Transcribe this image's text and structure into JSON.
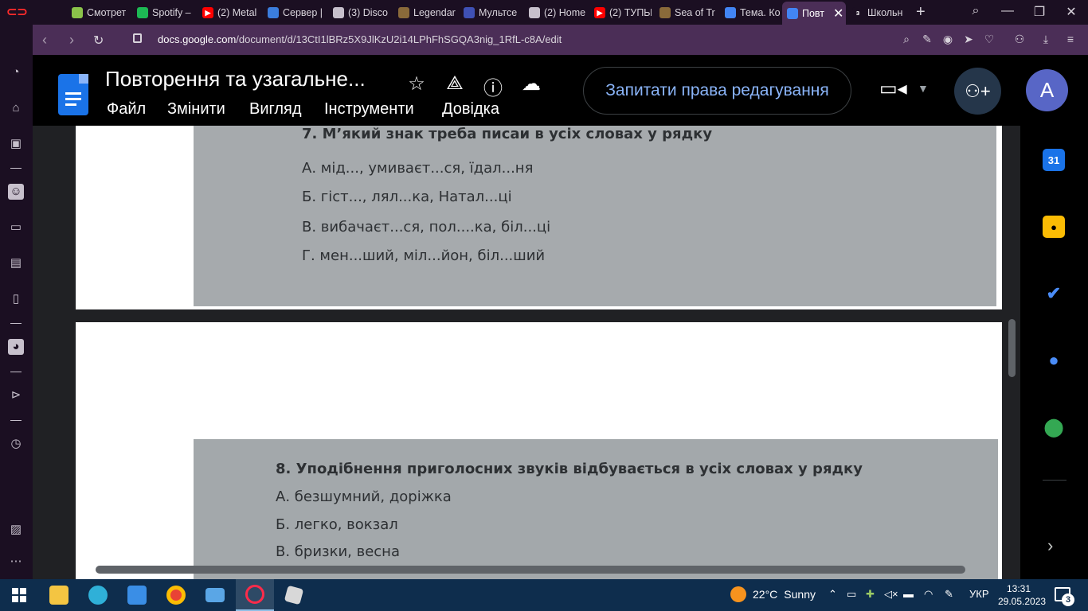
{
  "browser": {
    "tabs": [
      {
        "label": "Смотрет",
        "color": "#8bc34a",
        "glyph": ""
      },
      {
        "label": "Spotify –",
        "color": "#1db954",
        "glyph": ""
      },
      {
        "label": "(2) Metal",
        "color": "#ff0000",
        "glyph": "▶"
      },
      {
        "label": "Сервер |",
        "color": "#3b7ddd",
        "glyph": ""
      },
      {
        "label": "(3) Disco",
        "color": "#c7c0cc",
        "glyph": ""
      },
      {
        "label": "Legendar",
        "color": "#8a6a3a",
        "glyph": ""
      },
      {
        "label": "Мультсе",
        "color": "#3f51b5",
        "glyph": ""
      },
      {
        "label": "(2) Home",
        "color": "#c7c0cc",
        "glyph": ""
      },
      {
        "label": "(2) ТУПЫ",
        "color": "#ff0000",
        "glyph": "▶"
      },
      {
        "label": "Sea of Tr",
        "color": "#8a6a3a",
        "glyph": ""
      },
      {
        "label": "Тема. Ко",
        "color": "#4285f4",
        "glyph": ""
      },
      {
        "label": "Повт",
        "color": "#4285f4",
        "glyph": "",
        "active": true
      },
      {
        "label": "Школьн",
        "color": "#1b0f22",
        "glyph": "з"
      }
    ],
    "url_domain": "docs.google.com",
    "url_path": "/document/d/13CtI1lBRz5X9JlKzU2i14LPhFhSGQA3nig_1RfL-c8A/edit"
  },
  "docs": {
    "title": "Повторення та узагальне...",
    "menu": [
      "Файл",
      "Змінити",
      "Вигляд",
      "Інструменти",
      "Довідка"
    ],
    "request_edit_label": "Запитати права редагування",
    "avatar_letter": "A",
    "calendar_day": "31"
  },
  "content": {
    "q7": {
      "title": "7. М’який знак треба писаи в усіх словах у рядку",
      "options": [
        "А. мід..., умиваєт...ся, їдал...ня",
        "Б. гіст..., лял...ка, Натал...ці",
        "В. вибачаєт...ся, пол....ка, біл...ці",
        "Г. мен...ший, міл...йон, біл...ший"
      ]
    },
    "q8": {
      "title": "8. Уподібнення приголосних звуків відбувається в усіх словах у рядку",
      "options": [
        "А. безшумний, доріжка",
        "Б. легко, вокзал",
        "В. бризки, весна"
      ]
    }
  },
  "taskbar": {
    "weather_temp": "22°C",
    "weather_cond": "Sunny",
    "lang": "УКР",
    "time": "13:31",
    "date": "29.05.2023",
    "notif_count": "3"
  }
}
